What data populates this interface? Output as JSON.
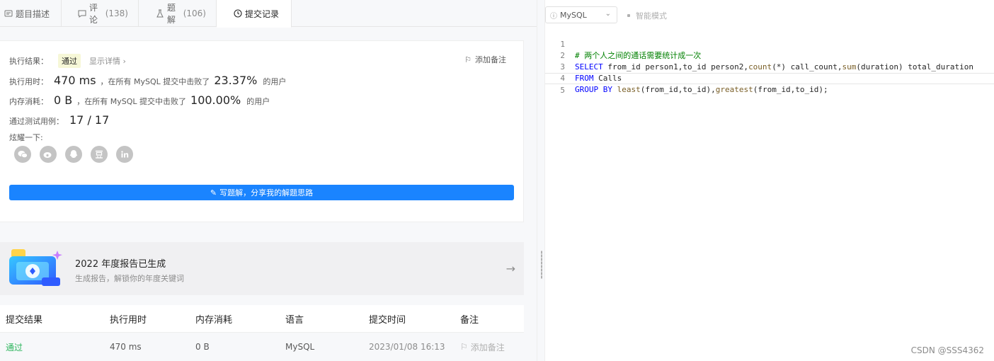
{
  "tabs": [
    {
      "label": "题目描述",
      "icon": "description-icon"
    },
    {
      "label": "评论",
      "count": "(138)",
      "icon": "comment-icon"
    },
    {
      "label": "题解",
      "count": "(106)",
      "icon": "flask-icon"
    },
    {
      "label": "提交记录",
      "icon": "clock-icon"
    }
  ],
  "result": {
    "status_label": "执行结果：",
    "status": "通过",
    "detail": "显示详情 ›",
    "add_note": "添加备注",
    "runtime_label": "执行用时：",
    "runtime": "470 ms",
    "runtime_mid": "，在所有 MySQL 提交中击败了",
    "runtime_pct": "23.37%",
    "runtime_tail": "的用户",
    "memory_label": "内存消耗：",
    "memory": "0 B",
    "memory_mid": "，在所有 MySQL 提交中击败了",
    "memory_pct": "100.00%",
    "memory_tail": "的用户",
    "tests_label": "通过测试用例：",
    "tests": "17 / 17",
    "share_label": "炫耀一下:",
    "share_icons": [
      "wechat-icon",
      "weibo-icon",
      "qq-icon",
      "douban-icon",
      "linkedin-icon"
    ],
    "write_button": "写题解，分享我的解题思路"
  },
  "banner": {
    "title": "2022 年度报告已生成",
    "subtitle": "生成报告，解锁你的年度关键词"
  },
  "table": {
    "headers": [
      "提交结果",
      "执行用时",
      "内存消耗",
      "语言",
      "提交时间",
      "备注"
    ],
    "rows": [
      {
        "result": "通过",
        "runtime": "470 ms",
        "memory": "0 B",
        "language": "MySQL",
        "time": "2023/01/08 16:13",
        "note": "添加备注"
      }
    ]
  },
  "editor": {
    "language": "MySQL",
    "smart_mode": "智能模式",
    "lines": [
      "# 两个人之间的通话需要统计成一次",
      "SELECT from_id person1,to_id person2,count(*) call_count,sum(duration) total_duration",
      "FROM Calls",
      "GROUP BY least(from_id,to_id),greatest(from_id,to_id);",
      ""
    ]
  },
  "watermark": "CSDN @SSS4362",
  "colors": {
    "accent": "#1a84ff",
    "success": "#2db55d",
    "keyword": "#0000ff",
    "comment": "#008000"
  }
}
